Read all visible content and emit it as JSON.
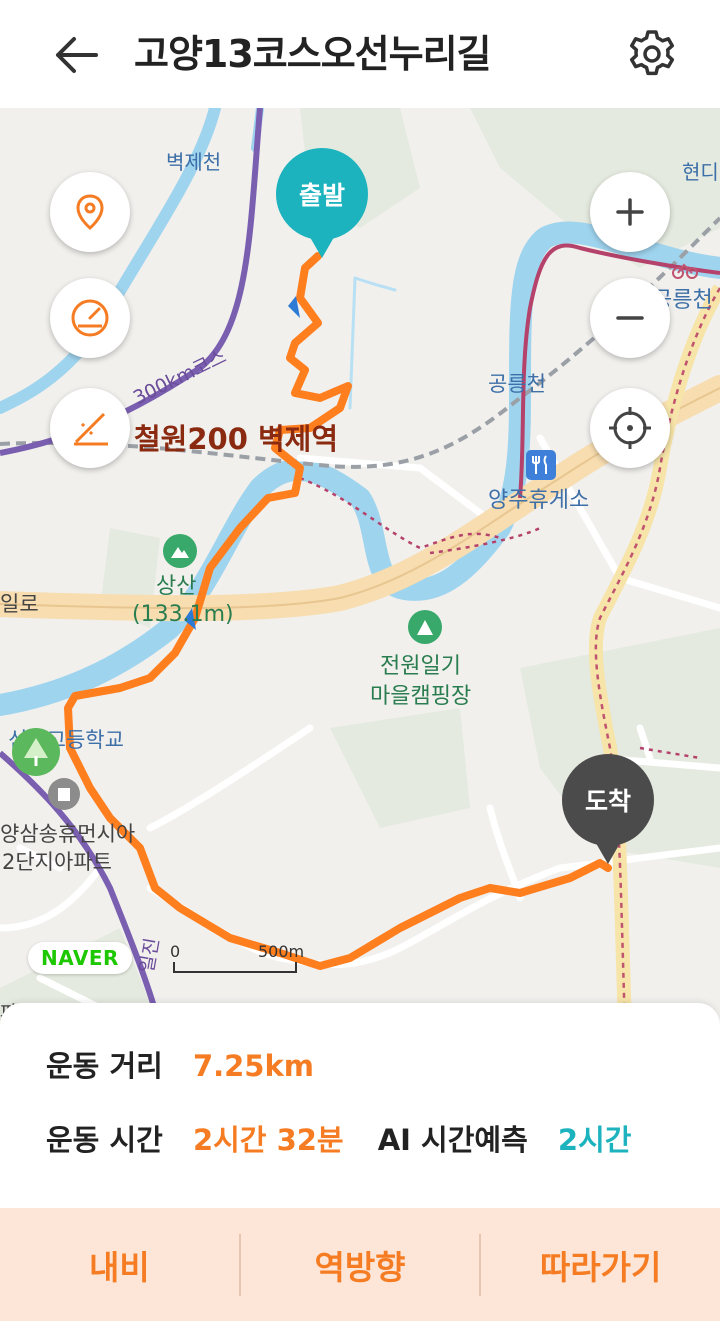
{
  "header": {
    "title": "고양13코스오선누리길"
  },
  "map": {
    "labels": {
      "byeokjecheon": "벽제천",
      "hyundai": "현디",
      "gongneungcheon_top": "공릉천",
      "gongneungcheon_mid": "공릉천",
      "route300": "300km코스",
      "station": "철원200 벽제역",
      "yangju_rest": "양주휴게소",
      "sangsan": "상산",
      "sangsan_elev": "(133.1m)",
      "road_left": "일로",
      "campsite_1": "전원일기",
      "campsite_2": "마을캠핑장",
      "school": "신일고등학교",
      "apt_1": "양삼송휴먼시아",
      "apt_2": "2단지아파트",
      "road_bottom": "일진",
      "bottom_left": "파트"
    },
    "pins": {
      "start": "출발",
      "end": "도착"
    },
    "scale": {
      "zero": "0",
      "dist": "500m"
    },
    "brand": "NAVER"
  },
  "stats": {
    "distance_label": "운동 거리",
    "distance_value": "7.25km",
    "time_label": "운동 시간",
    "time_value": "2시간 32분",
    "ai_label": "AI 시간예측",
    "ai_value": "2시간"
  },
  "actions": {
    "navi": "내비",
    "reverse": "역방향",
    "follow": "따라가기"
  },
  "colors": {
    "route": "#f57c22",
    "start_pin": "#1cb3bf",
    "end_pin": "#4b4b4b",
    "accent_bg": "#fde6d8"
  }
}
